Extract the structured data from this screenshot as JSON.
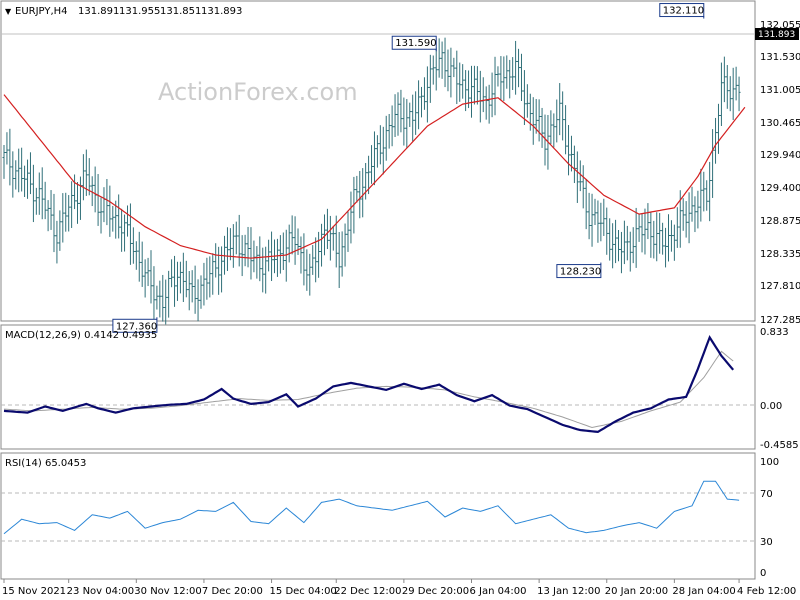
{
  "chart_data": [
    {
      "panel": "price",
      "type": "ohlc",
      "title": "EURJPY,H4",
      "ohlc_readout": [
        "131.891",
        "131.955",
        "131.851",
        "131.893"
      ],
      "watermark": "ActionForex.com",
      "ylim": [
        127.285,
        132.055
      ],
      "y_ticks": [
        "132.055",
        "131.530",
        "131.005",
        "130.465",
        "129.940",
        "129.400",
        "128.875",
        "128.335",
        "127.810",
        "127.285"
      ],
      "current_price": "131.893",
      "series": [
        {
          "name": "close",
          "color": "#2f6f78",
          "x_index": [
            0,
            6,
            12,
            18,
            23,
            28,
            33,
            39,
            44,
            49,
            54,
            59,
            64,
            69,
            74,
            79,
            84,
            89,
            94,
            99,
            104,
            109,
            114,
            119,
            124,
            129,
            134,
            139,
            144,
            149,
            154,
            159,
            164,
            169,
            174,
            179,
            184,
            189,
            194,
            199,
            204,
            209,
            214,
            219,
            224,
            229,
            234,
            239,
            244
          ],
          "values": [
            129.9,
            129.6,
            129.3,
            128.7,
            129.2,
            129.6,
            129.1,
            128.9,
            128.5,
            127.9,
            127.6,
            128.1,
            127.7,
            127.95,
            128.3,
            128.6,
            128.3,
            128.2,
            128.4,
            128.6,
            128.0,
            128.8,
            128.3,
            129.2,
            129.7,
            130.2,
            130.6,
            130.5,
            131.1,
            131.5,
            131.1,
            131.0,
            130.8,
            131.2,
            131.3,
            130.6,
            130.2,
            130.6,
            129.7,
            129.0,
            128.8,
            128.4,
            128.6,
            128.8,
            128.5,
            128.8,
            129.1,
            129.3,
            131.0
          ]
        },
        {
          "name": "moving-average",
          "color": "#d42020",
          "x_index": [
            0,
            12,
            24,
            36,
            48,
            60,
            72,
            84,
            96,
            108,
            120,
            132,
            144,
            156,
            168,
            180,
            192,
            204,
            216,
            228,
            236,
            242,
            247,
            252
          ],
          "values": [
            130.9,
            130.2,
            129.5,
            129.2,
            128.8,
            128.5,
            128.35,
            128.3,
            128.35,
            128.6,
            129.2,
            129.8,
            130.4,
            130.75,
            130.85,
            130.4,
            129.8,
            129.3,
            129.0,
            129.1,
            129.6,
            130.1,
            130.4,
            130.7
          ]
        }
      ],
      "annotations": [
        {
          "label": "127.360",
          "x_index": 52,
          "y": 127.36
        },
        {
          "label": "131.590",
          "x_index": 147,
          "y": 131.59
        },
        {
          "label": "128.230",
          "x_index": 203,
          "y": 128.23
        },
        {
          "label": "132.110",
          "x_index": 238,
          "y": 132.11
        }
      ]
    },
    {
      "panel": "macd",
      "type": "line",
      "title": "MACD(12,26,9) 0.4142 0.4935",
      "ylim": [
        -0.4585,
        0.833
      ],
      "y_ticks": [
        "0.833",
        "0.00",
        "-0.4585"
      ],
      "series": [
        {
          "name": "macd",
          "color": "#0a0a6e",
          "x_index": [
            0,
            8,
            14,
            20,
            28,
            32,
            38,
            44,
            50,
            56,
            62,
            68,
            74,
            78,
            84,
            90,
            96,
            100,
            106,
            112,
            118,
            124,
            130,
            136,
            142,
            148,
            154,
            160,
            166,
            172,
            178,
            184,
            190,
            196,
            202,
            208,
            214,
            220,
            226,
            232,
            236,
            240,
            244,
            248
          ],
          "values": [
            -0.08,
            -0.1,
            -0.03,
            -0.08,
            0.0,
            -0.05,
            -0.1,
            -0.05,
            -0.03,
            -0.01,
            0.0,
            0.05,
            0.17,
            0.06,
            0.0,
            0.02,
            0.11,
            -0.03,
            0.06,
            0.2,
            0.24,
            0.2,
            0.16,
            0.23,
            0.17,
            0.22,
            0.1,
            0.03,
            0.1,
            -0.02,
            -0.06,
            -0.15,
            -0.24,
            -0.3,
            -0.32,
            -0.2,
            -0.1,
            -0.05,
            0.05,
            0.08,
            0.4,
            0.76,
            0.55,
            0.39
          ]
        },
        {
          "name": "signal",
          "color": "#a0a0a0",
          "x_index": [
            0,
            10,
            20,
            30,
            40,
            50,
            60,
            70,
            80,
            90,
            100,
            110,
            120,
            130,
            140,
            150,
            160,
            170,
            180,
            190,
            200,
            210,
            220,
            230,
            238,
            244,
            248
          ],
          "values": [
            -0.06,
            -0.08,
            -0.06,
            -0.04,
            -0.06,
            -0.05,
            -0.02,
            0.02,
            0.06,
            0.04,
            0.05,
            0.12,
            0.18,
            0.2,
            0.19,
            0.16,
            0.08,
            0.02,
            -0.05,
            -0.15,
            -0.27,
            -0.2,
            -0.08,
            0.02,
            0.3,
            0.6,
            0.49
          ]
        }
      ]
    },
    {
      "panel": "rsi",
      "type": "line",
      "title": "RSI(14) 65.0453",
      "ylim": [
        0,
        100
      ],
      "y_ticks": [
        "100",
        "70",
        "30",
        "0"
      ],
      "levels": [
        70,
        30
      ],
      "series": [
        {
          "name": "rsi",
          "color": "#2a86d6",
          "x_index": [
            0,
            6,
            12,
            18,
            24,
            30,
            36,
            42,
            48,
            54,
            60,
            66,
            72,
            78,
            84,
            90,
            96,
            102,
            108,
            114,
            120,
            126,
            132,
            138,
            144,
            150,
            156,
            162,
            168,
            174,
            180,
            186,
            192,
            198,
            204,
            210,
            216,
            222,
            228,
            234,
            238,
            242,
            246,
            250
          ],
          "values": [
            35,
            48,
            44,
            45,
            38,
            52,
            49,
            55,
            40,
            45,
            48,
            56,
            55,
            63,
            46,
            44,
            58,
            45,
            63,
            66,
            60,
            58,
            56,
            60,
            64,
            50,
            58,
            55,
            60,
            44,
            48,
            52,
            40,
            36,
            38,
            42,
            45,
            40,
            55,
            60,
            82,
            82,
            66,
            65
          ]
        }
      ]
    }
  ],
  "x_axis": {
    "n_bars": 252,
    "tick_x_index": [
      0,
      22,
      45,
      68,
      91,
      113,
      136,
      159,
      182,
      205,
      228
    ],
    "labels": [
      "15 Nov 2021",
      "23 Nov 04:00",
      "30 Nov 12:00",
      "7 Dec 20:00",
      "15 Dec 04:00",
      "22 Dec 12:00",
      "29 Dec 20:00",
      "6 Jan 04:00",
      "13 Jan 12:00",
      "20 Jan 20:00",
      "28 Jan 04:00",
      "4 Feb 12:00"
    ]
  },
  "colors": {
    "bars": "#2f6f78",
    "ma": "#d42020",
    "macd": "#0a0a6e",
    "signal": "#a0a0a0",
    "rsi": "#2a86d6",
    "grid_dash": "#b8b8b8",
    "frame": "#888888",
    "watermark": "#cccccc"
  }
}
